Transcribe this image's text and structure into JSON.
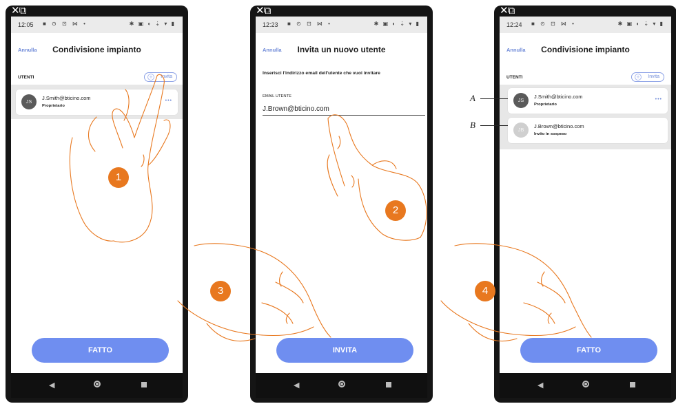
{
  "phones": [
    {
      "status": {
        "time": "12:05",
        "left_icons": "■ ⊙ ⊡ ⋈ •",
        "right_icons": "✱ ▣ ◐ ⇣ ▾ ▮"
      },
      "header": {
        "cancel": "Annulla",
        "title": "Condivisione impianto"
      },
      "section_label": "UTENTI",
      "invite_button": "Invita",
      "users": [
        {
          "initials": "JS",
          "email": "J.Smith@bticino.com",
          "role": "Proprietario",
          "more": "•••"
        }
      ],
      "done_button": "FATTO"
    },
    {
      "status": {
        "time": "12:23",
        "left_icons": "■ ⊙ ⊡ ⋈ •",
        "right_icons": "✱ ▣ ◐ ⇣ ▾ ▮"
      },
      "header": {
        "cancel": "Annulla",
        "title": "Invita un nuovo utente"
      },
      "description": "Inserisci l'indirizzo email dell'utente che vuoi invitare",
      "email_label": "EMAIL UTENTE",
      "email_value": "J.Brown@bticino.com",
      "invite_submit": "INVITA"
    },
    {
      "status": {
        "time": "12:24",
        "left_icons": "■ ⊙ ⊡ ⋈ •",
        "right_icons": "✱ ▣ ◐ ⇣ ▾ ▮"
      },
      "header": {
        "cancel": "Annulla",
        "title": "Condivisione impianto"
      },
      "section_label": "UTENTI",
      "invite_button": "Invita",
      "users": [
        {
          "initials": "JS",
          "email": "J.Smith@bticino.com",
          "role": "Proprietario",
          "more": "•••"
        },
        {
          "initials": "JB",
          "email": "J.Brown@bticino.com",
          "role": "Invito in sospeso"
        }
      ],
      "done_button": "FATTO"
    }
  ],
  "steps": [
    "1",
    "2",
    "3",
    "4"
  ],
  "callouts": [
    "A",
    "B"
  ],
  "colors": {
    "accent": "#6f8ef0",
    "step_badge": "#e8781f",
    "avatar": "#5a5a5a",
    "avatar_pending": "#cfcfcf"
  },
  "icons": {
    "back": "◀",
    "home": "home-circle",
    "recent": "square",
    "corner": "close-expand-icon"
  }
}
